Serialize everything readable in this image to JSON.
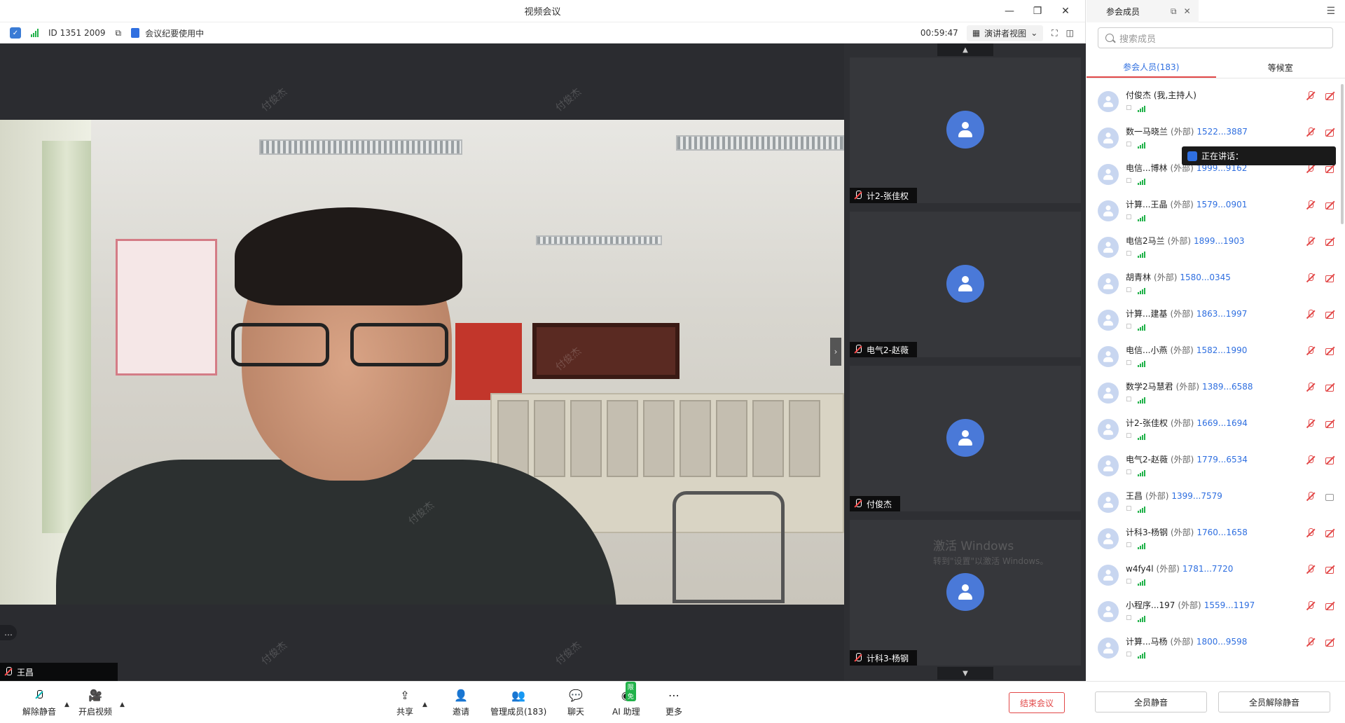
{
  "window": {
    "title": "视频会议"
  },
  "info": {
    "meeting_id": "ID 1351 2009",
    "minutes_status": "会议纪要使用中",
    "timer": "00:59:47",
    "view_label": "演讲者视图"
  },
  "main": {
    "speaker_name": "王昌",
    "watermark": "付俊杰"
  },
  "thumbs": [
    {
      "name": "计2-张佳权"
    },
    {
      "name": "电气2-赵薇"
    },
    {
      "name": "付俊杰"
    },
    {
      "name": "计科3-杨钢"
    }
  ],
  "toolbar": {
    "unmute": "解除静音",
    "start_video": "开启视频",
    "share": "共享",
    "invite": "邀请",
    "manage": "管理成员(183)",
    "chat": "聊天",
    "ai": "AI 助理",
    "ai_badge": "限免",
    "more": "更多",
    "end": "结束会议"
  },
  "panel": {
    "title": "参会成员",
    "search_placeholder": "搜索成员",
    "tab_participants": "参会人员(183)",
    "tab_waiting": "等候室",
    "tooltip": "正在讲话：",
    "mute_all": "全员静音",
    "unmute_all": "全员解除静音",
    "members": [
      {
        "name": "付俊杰 (我,主持人)",
        "tag": "",
        "phone": ""
      },
      {
        "name": "数一马晓兰",
        "tag": "(外部)",
        "phone": "1522...3887"
      },
      {
        "name": "电信...博林",
        "tag": "(外部)",
        "phone": "1999...9162"
      },
      {
        "name": "计算...王晶",
        "tag": "(外部)",
        "phone": "1579...0901"
      },
      {
        "name": "电信2马兰",
        "tag": "(外部)",
        "phone": "1899...1903"
      },
      {
        "name": "胡青林",
        "tag": "(外部)",
        "phone": "1580...0345"
      },
      {
        "name": "计算...建基",
        "tag": "(外部)",
        "phone": "1863...1997"
      },
      {
        "name": "电信...小燕",
        "tag": "(外部)",
        "phone": "1582...1990"
      },
      {
        "name": "数学2马慧君",
        "tag": "(外部)",
        "phone": "1389...6588"
      },
      {
        "name": "计2-张佳权",
        "tag": "(外部)",
        "phone": "1669...1694"
      },
      {
        "name": "电气2-赵薇",
        "tag": "(外部)",
        "phone": "1779...6534"
      },
      {
        "name": "王昌",
        "tag": "(外部)",
        "phone": "1399...7579"
      },
      {
        "name": "计科3-杨钢",
        "tag": "(外部)",
        "phone": "1760...1658"
      },
      {
        "name": "w4fy4l",
        "tag": "(外部)",
        "phone": "1781...7720"
      },
      {
        "name": "小程序...197",
        "tag": "(外部)",
        "phone": "1559...1197"
      },
      {
        "name": "计算...马杨",
        "tag": "(外部)",
        "phone": "1800...9598"
      }
    ]
  },
  "windows_activation": {
    "line1": "激活 Windows",
    "line2": "转到\"设置\"以激活 Windows。"
  }
}
